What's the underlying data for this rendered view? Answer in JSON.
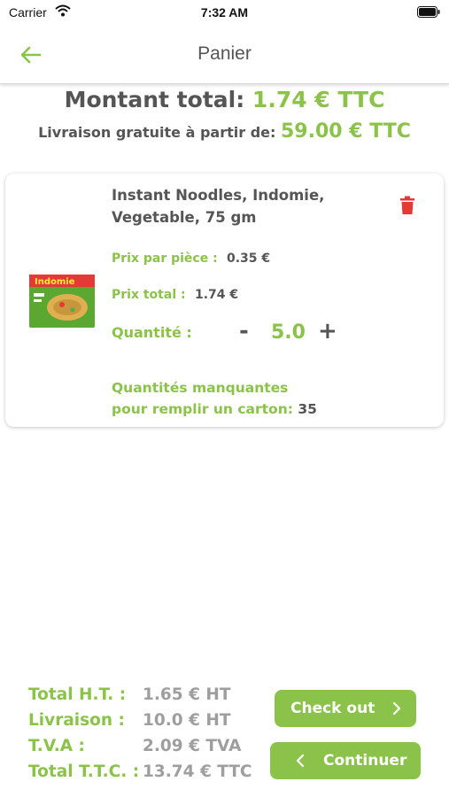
{
  "status_bar": {
    "carrier": "Carrier",
    "time": "7:32 AM"
  },
  "nav": {
    "title": "Panier"
  },
  "totals_header": {
    "total_label": "Montant total:",
    "total_value": "1.74 € TTC",
    "delivery_label": "Livraison gratuite à partir de:",
    "delivery_value": "59.00 € TTC"
  },
  "cart_item": {
    "name": "Instant Noodles, Indomie, Vegetable, 75 gm",
    "unit_price_label": "Prix par pièce :",
    "unit_price_value": "0.35 €",
    "total_price_label": "Prix total :",
    "total_price_value": "1.74 €",
    "quantity_label": "Quantité :",
    "quantity_minus": "-",
    "quantity_value": "5.0",
    "quantity_plus": "+",
    "missing_label_line1": "Quantités manquantes",
    "missing_label_line2": "pour remplir un carton:",
    "missing_value": "35",
    "image_brand_text": "Indomie"
  },
  "summary": {
    "rows": [
      {
        "label": "Total H.T. :",
        "value": "1.65 € HT"
      },
      {
        "label": "Livraison :",
        "value": "10.0 € HT"
      },
      {
        "label": "T.V.A :",
        "value": "2.09 € TVA"
      },
      {
        "label": "Total T.T.C. :",
        "value": "13.74 € TTC"
      }
    ]
  },
  "buttons": {
    "checkout": "Check out",
    "continue": "Continuer"
  },
  "colors": {
    "accent": "#8bc34a",
    "text": "#555555",
    "muted": "#9e9e9e",
    "delete": "#e53935"
  },
  "icons": [
    "wifi-icon",
    "battery-icon",
    "back-arrow-icon",
    "delete-icon",
    "chevron-right-icon",
    "chevron-left-icon"
  ]
}
